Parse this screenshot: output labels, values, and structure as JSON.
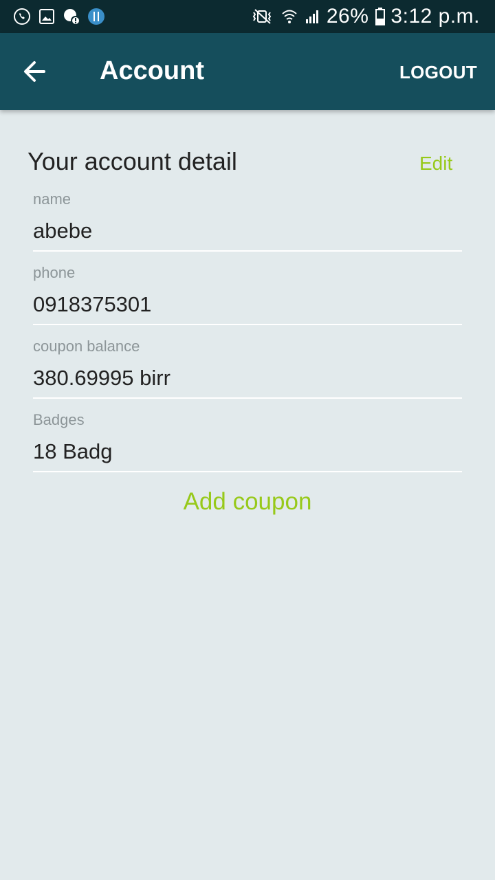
{
  "status_bar": {
    "left_icons": [
      "whatsapp-icon",
      "image-icon",
      "chat-alert-icon",
      "restaurant-app-icon"
    ],
    "right_icons": [
      "vibrate-mute-icon",
      "wifi-icon",
      "signal-icon"
    ],
    "battery": "26%",
    "time": "3:12 p.m."
  },
  "app_bar": {
    "back_icon": "arrow-left-icon",
    "title": "Account",
    "logout_label": "LOGOUT",
    "background": "#154e5c"
  },
  "account": {
    "heading": "Your account detail",
    "edit_label": "Edit",
    "fields": [
      {
        "label": "name",
        "value": "abebe"
      },
      {
        "label": "phone",
        "value": "0918375301"
      },
      {
        "label": "coupon balance",
        "value": "380.69995 birr"
      },
      {
        "label": "Badges",
        "value": "18 Badg"
      }
    ],
    "add_coupon_label": "Add coupon"
  },
  "colors": {
    "accent": "#97c91a",
    "background": "#e2eaec",
    "status_bar": "#0c2a30"
  }
}
